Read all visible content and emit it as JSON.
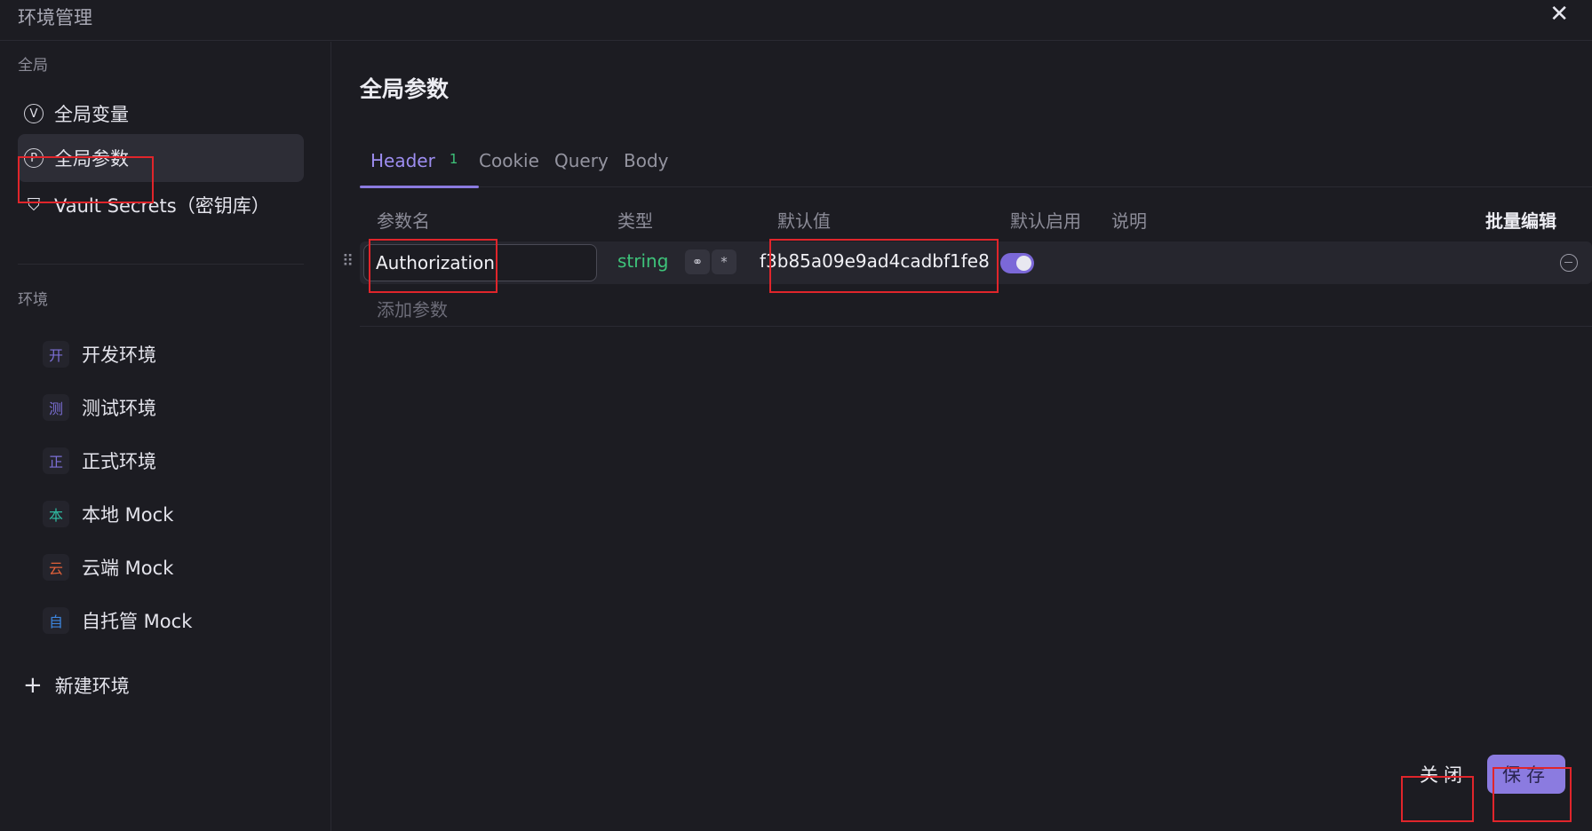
{
  "window": {
    "title": "环境管理",
    "close_glyph": "✕"
  },
  "sidebar": {
    "global_section_label": "全局",
    "global_items": [
      {
        "label": "全局变量",
        "icon": "v-circle-icon",
        "glyph": "V",
        "active": false
      },
      {
        "label": "全局参数",
        "icon": "p-circle-icon",
        "glyph": "P",
        "active": true
      },
      {
        "label": "Vault Secrets（密钥库）",
        "icon": "shield-icon",
        "glyph": "⛉",
        "active": false
      }
    ],
    "env_section_label": "环境",
    "environments": [
      {
        "badge": "开",
        "label": "开发环境",
        "color": "#7c6fd6"
      },
      {
        "badge": "测",
        "label": "测试环境",
        "color": "#7c6fd6"
      },
      {
        "badge": "正",
        "label": "正式环境",
        "color": "#7c6fd6"
      },
      {
        "badge": "本",
        "label": "本地 Mock",
        "color": "#2fb9a0"
      },
      {
        "badge": "云",
        "label": "云端 Mock",
        "color": "#e0603a"
      },
      {
        "badge": "自",
        "label": "自托管 Mock",
        "color": "#3d86e0"
      }
    ],
    "new_env_label": "新建环境",
    "new_env_glyph": "+"
  },
  "main": {
    "title": "全局参数",
    "tabs": [
      {
        "label": "Header",
        "count": "1",
        "active": true
      },
      {
        "label": "Cookie",
        "active": false
      },
      {
        "label": "Query",
        "active": false
      },
      {
        "label": "Body",
        "active": false
      }
    ],
    "columns": {
      "name": "参数名",
      "type": "类型",
      "default_value": "默认值",
      "default_enabled": "默认启用",
      "description": "说明"
    },
    "bulk_edit_label": "批量编辑",
    "params": [
      {
        "name": "Authorization",
        "type": "string",
        "default_value": "f3b85a09e9ad4cadbf1fe8",
        "enabled": true,
        "description": ""
      }
    ],
    "add_param_label": "添加参数",
    "row_glyphs": {
      "drag": "⠿",
      "link": "⚭",
      "required": "*"
    }
  },
  "footer": {
    "close_label": "关闭",
    "save_label": "保存"
  },
  "colors": {
    "accent": "#8b7be0",
    "string_type": "#3ec37a",
    "highlight_box": "#e0252b",
    "background": "#1c1c22"
  }
}
